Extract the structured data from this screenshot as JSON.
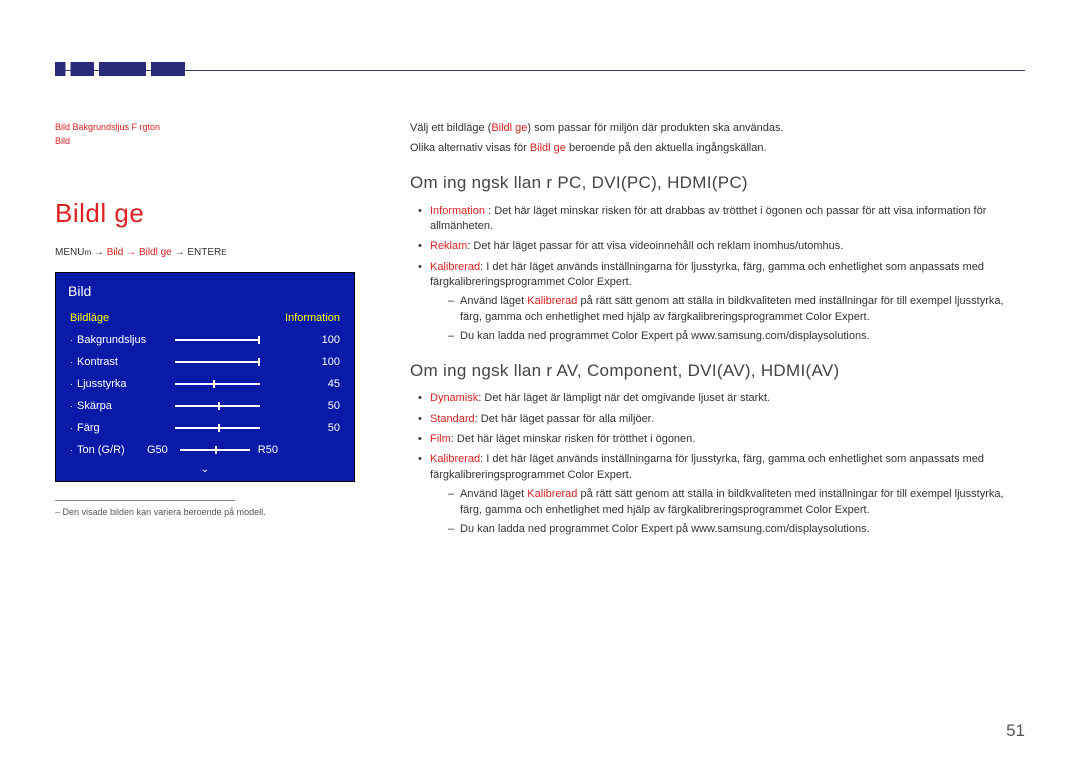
{
  "top_note_line1": "Bild Bakgrundsljus F rgton",
  "top_note_line2": "Bild",
  "page_heading": "Bildl ge",
  "nav": {
    "menu": "MENU",
    "m": "m",
    "arrow": " → ",
    "seg1": "Bild",
    "seg2": "Bildl ge",
    "enter": "ENTER",
    "e": "E"
  },
  "osd": {
    "title": "Bild",
    "row_label": "Bildläge",
    "row_value": "Information",
    "items": [
      {
        "label": "Bakgrundsljus",
        "value": "100",
        "knob": 100
      },
      {
        "label": "Kontrast",
        "value": "100",
        "knob": 100
      },
      {
        "label": "Ljusstyrka",
        "value": "45",
        "knob": 45
      },
      {
        "label": "Skärpa",
        "value": "50",
        "knob": 50
      },
      {
        "label": "Färg",
        "value": "50",
        "knob": 50
      }
    ],
    "ton": {
      "label": "Ton (G/R)",
      "g": "G50",
      "r": "R50"
    }
  },
  "footnote": "Den visade bilden kan variera beroende på modell.",
  "intro1a": "Välj ett bildläge (",
  "intro1b": "Bildl ge",
  "intro1c": ") som passar för miljön där produkten ska användas.",
  "intro2a": "Olika alternativ visas för ",
  "intro2b": "Bildl ge",
  "intro2c": " beroende på den aktuella ingångskällan.",
  "sec1_h": "Om ing ngsk llan  r  PC, DVI(PC), HDMI(PC)",
  "b1a": "Information",
  "b1b": " : Det här läget minskar risken för att drabbas av trötthet i ögonen och passar för att visa information för allmänheten.",
  "b2a": "Reklam",
  "b2b": ": Det här läget passar för att visa videoinnehåll och reklam inomhus/utomhus.",
  "b3a": "Kalibrerad",
  "b3b": ": I det här läget används inställningarna för ljusstyrka, färg, gamma och enhetlighet som anpassats med färgkalibreringsprogrammet Color Expert.",
  "d1a": "Använd läget ",
  "d1b": "Kalibrerad",
  "d1c": " på rätt sätt genom att ställa in bildkvaliteten med inställningar för till exempel ljusstyrka, färg, gamma och enhetlighet med hjälp av färgkalibreringsprogrammet Color Expert.",
  "d2": "Du kan ladda ned programmet Color Expert på www.samsung.com/displaysolutions.",
  "sec2_h": "Om ing ngsk llan  r  AV, Component, DVI(AV), HDMI(AV)",
  "c1a": "Dynamisk",
  "c1b": ": Det här läget är lämpligt när det omgivande ljuset är starkt.",
  "c2a": "Standard",
  "c2b": ": Det här läget passar för alla miljöer.",
  "c3a": "Film",
  "c3b": ": Det här läget minskar risken för trötthet i ögonen.",
  "c4a": "Kalibrerad",
  "c4b": ": I det här läget används inställningarna för ljusstyrka, färg, gamma och enhetlighet som anpassats med färgkalibreringsprogrammet Color Expert.",
  "e1a": "Använd läget ",
  "e1b": "Kalibrerad",
  "e1c": " på rätt sätt genom att ställa in bildkvaliteten med inställningar för till exempel ljusstyrka, färg, gamma och enhetlighet med hjälp av färgkalibreringsprogrammet Color Expert.",
  "e2": "Du kan ladda ned programmet Color Expert på www.samsung.com/displaysolutions.",
  "page_num": "51"
}
